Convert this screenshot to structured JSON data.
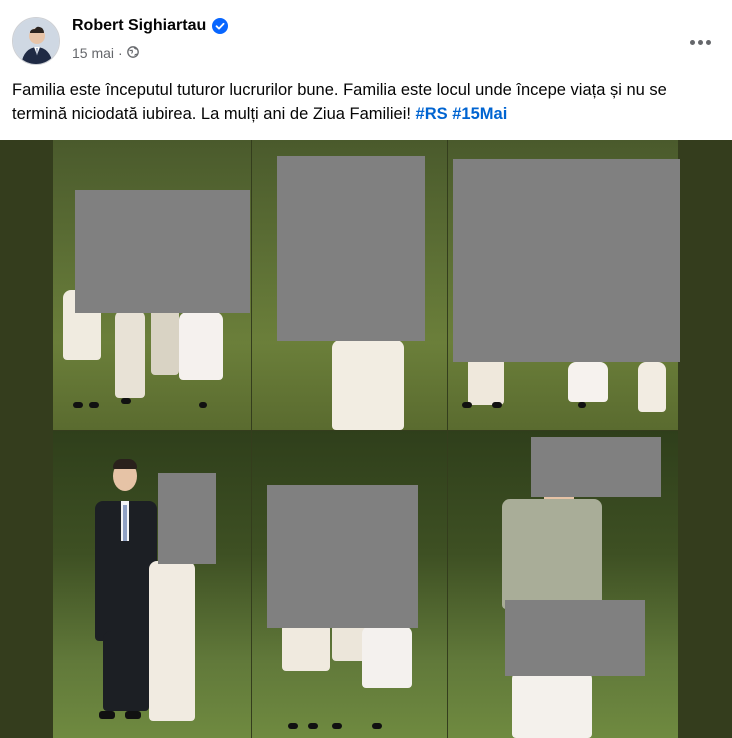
{
  "post": {
    "author": "Robert Sighiartau",
    "date": "15 mai",
    "separator": "·",
    "text_main": "Familia este începutul tuturor lucrurilor bune. Familia este locul unde începe viața și nu se termină niciodată iubirea. La mulți ani de Ziua Familiei!",
    "hashtags": [
      "#RS",
      "#15Mai"
    ]
  },
  "icons": {
    "verified": "verified-badge-icon",
    "privacy": "globe-icon",
    "more": "more-options-icon"
  },
  "colors": {
    "verified": "#0866ff",
    "hashtag": "#0064d1",
    "photo_background": "#343d1d",
    "redaction": "#808080"
  }
}
